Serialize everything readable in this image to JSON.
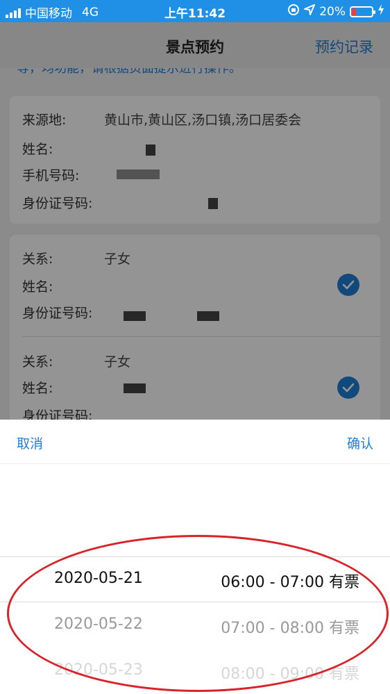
{
  "status_bar": {
    "carrier": "中国移动",
    "network": "4G",
    "time": "上午11:42",
    "battery": "20%",
    "battery_level": 0.2
  },
  "nav": {
    "title": "景点预约",
    "right_link": "预约记录"
  },
  "notice_text": "等，均功能，请根据页面提示进行操作。",
  "applicant": {
    "origin_label": "来源地:",
    "origin_value": "黄山市,黄山区,汤口镇,汤口居委会",
    "name_label": "姓名:",
    "phone_label": "手机号码:",
    "id_label": "身份证号码:"
  },
  "companions": [
    {
      "relation_label": "关系:",
      "relation_value": "子女",
      "name_label": "姓名:",
      "id_label": "身份证号码:",
      "checked": true
    },
    {
      "relation_label": "关系:",
      "relation_value": "子女",
      "name_label": "姓名:",
      "id_label": "身份证号码:",
      "checked": true
    }
  ],
  "picker": {
    "cancel": "取消",
    "confirm": "确认",
    "options": [
      {
        "date": "2020-05-21",
        "time": "06:00 - 07:00 有票"
      },
      {
        "date": "2020-05-22",
        "time": "07:00 - 08:00 有票"
      },
      {
        "date": "2020-05-23",
        "time": "08:00 - 09:00 有票"
      }
    ]
  },
  "colors": {
    "accent": "#1f7fd8",
    "status_bar": "#1f90e6",
    "annotation": "#d9232b"
  }
}
